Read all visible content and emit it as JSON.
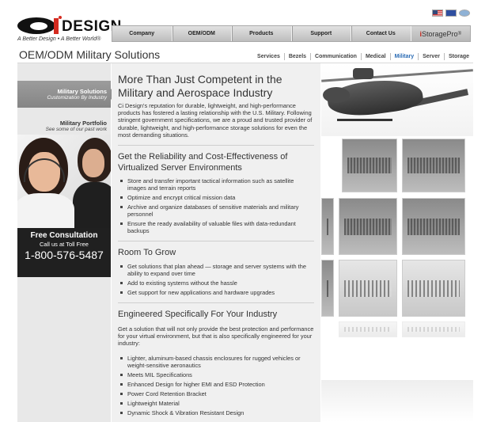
{
  "brand": {
    "name": "DESIGN",
    "tagline": "A Better Design • A Better World®"
  },
  "flags": [
    "us-flag-icon",
    "eu-flag-icon",
    "un-flag-icon"
  ],
  "nav": {
    "items": [
      "Company",
      "OEM/ODM",
      "Products",
      "Support",
      "Contact Us"
    ],
    "store_prefix": "i",
    "store_label": "StoragePro",
    "store_suffix": "®"
  },
  "page_title": "OEM/ODM Military Solutions",
  "subnav": {
    "items": [
      "Services",
      "Bezels",
      "Communication",
      "Medical",
      "Military",
      "Server",
      "Storage"
    ],
    "active": "Military"
  },
  "sidebar": {
    "items": [
      {
        "title": "Military Solutions",
        "subtitle": "Customization By Industry"
      },
      {
        "title": "Military Portfolio",
        "subtitle": "See some of our past work"
      }
    ]
  },
  "promo": {
    "heading": "Free Consultation",
    "line": "Call us at Toll Free",
    "phone": "1-800-576-5487"
  },
  "content": {
    "heading": "More Than Just Competent in the Military and Aerospace Industry",
    "intro": "Ci Design's reputation for durable, lightweight, and high-performance products has fostered a lasting relationship with the U.S. Military. Following stringent government specifications, we are a proud and trusted provider of durable, lightweight, and high-performance storage solutions for even the most demanding situations.",
    "sections": [
      {
        "heading": "Get the Reliability and Cost-Effectiveness of Virtualized Server Environments",
        "items": [
          "Store and transfer important tactical information such as satellite images and terrain reports",
          "Optimize and encrypt critical mission data",
          "Archive and organize databases of sensitive materials and military personnel",
          "Ensure the ready availability of valuable files with data-redundant backups"
        ]
      },
      {
        "heading": "Room To Grow",
        "items": [
          "Get solutions that plan ahead — storage and server systems with the ability to expand over time",
          "Add to existing systems without the hassle",
          "Get support for new applications and hardware upgrades"
        ]
      },
      {
        "heading": "Engineered Specifically For Your Industry",
        "intro": "Get a solution that will not only provide the best protection and performance for your virtual environment, but that is also specifically engineered for your industry:",
        "items": [
          "Lighter, aluminum-based chassis enclosures for rugged vehicles or weight-sensitive aeronautics",
          "Meets MIL Specifications",
          "Enhanced Design for higher EMI and ESD Protection",
          "Power Cord Retention Bracket",
          "Lightweight Material",
          "Dynamic Shock & Vibration Resistant Design"
        ]
      }
    ]
  },
  "colors": {
    "accent_red": "#d42a1f",
    "active_blue": "#2a6bb4",
    "promo_bg": "#202020"
  }
}
